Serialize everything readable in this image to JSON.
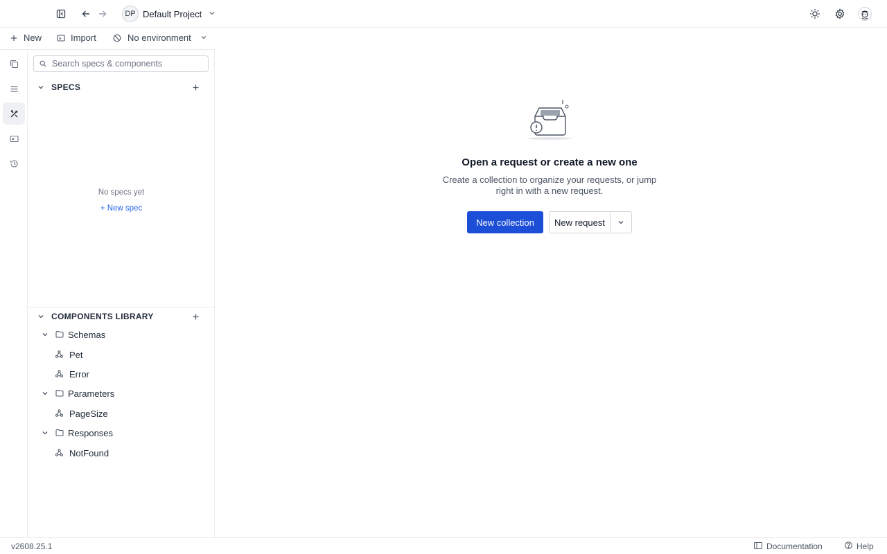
{
  "topbar": {
    "project_initials": "DP",
    "project_name": "Default Project"
  },
  "sidebar_toolbar": {
    "new_label": "New",
    "import_label": "Import",
    "environment_label": "No environment"
  },
  "search": {
    "placeholder": "Search specs & components"
  },
  "specs": {
    "title": "SPECS",
    "empty_text": "No specs yet",
    "new_spec_link": "+ New spec"
  },
  "components": {
    "title": "COMPONENTS LIBRARY",
    "groups": [
      {
        "label": "Schemas",
        "items": [
          "Pet",
          "Error"
        ]
      },
      {
        "label": "Parameters",
        "items": [
          "PageSize"
        ]
      },
      {
        "label": "Responses",
        "items": [
          "NotFound"
        ]
      }
    ]
  },
  "main": {
    "empty_title": "Open a request or create a new one",
    "empty_subtitle": "Create a collection to organize your requests, or jump right in with a new request.",
    "new_collection_label": "New collection",
    "new_request_label": "New request"
  },
  "statusbar": {
    "version": "v2608.25.1",
    "documentation_label": "Documentation",
    "help_label": "Help"
  },
  "colors": {
    "primary": "#1d4ed8",
    "link": "#2563eb",
    "border": "#ececec"
  }
}
